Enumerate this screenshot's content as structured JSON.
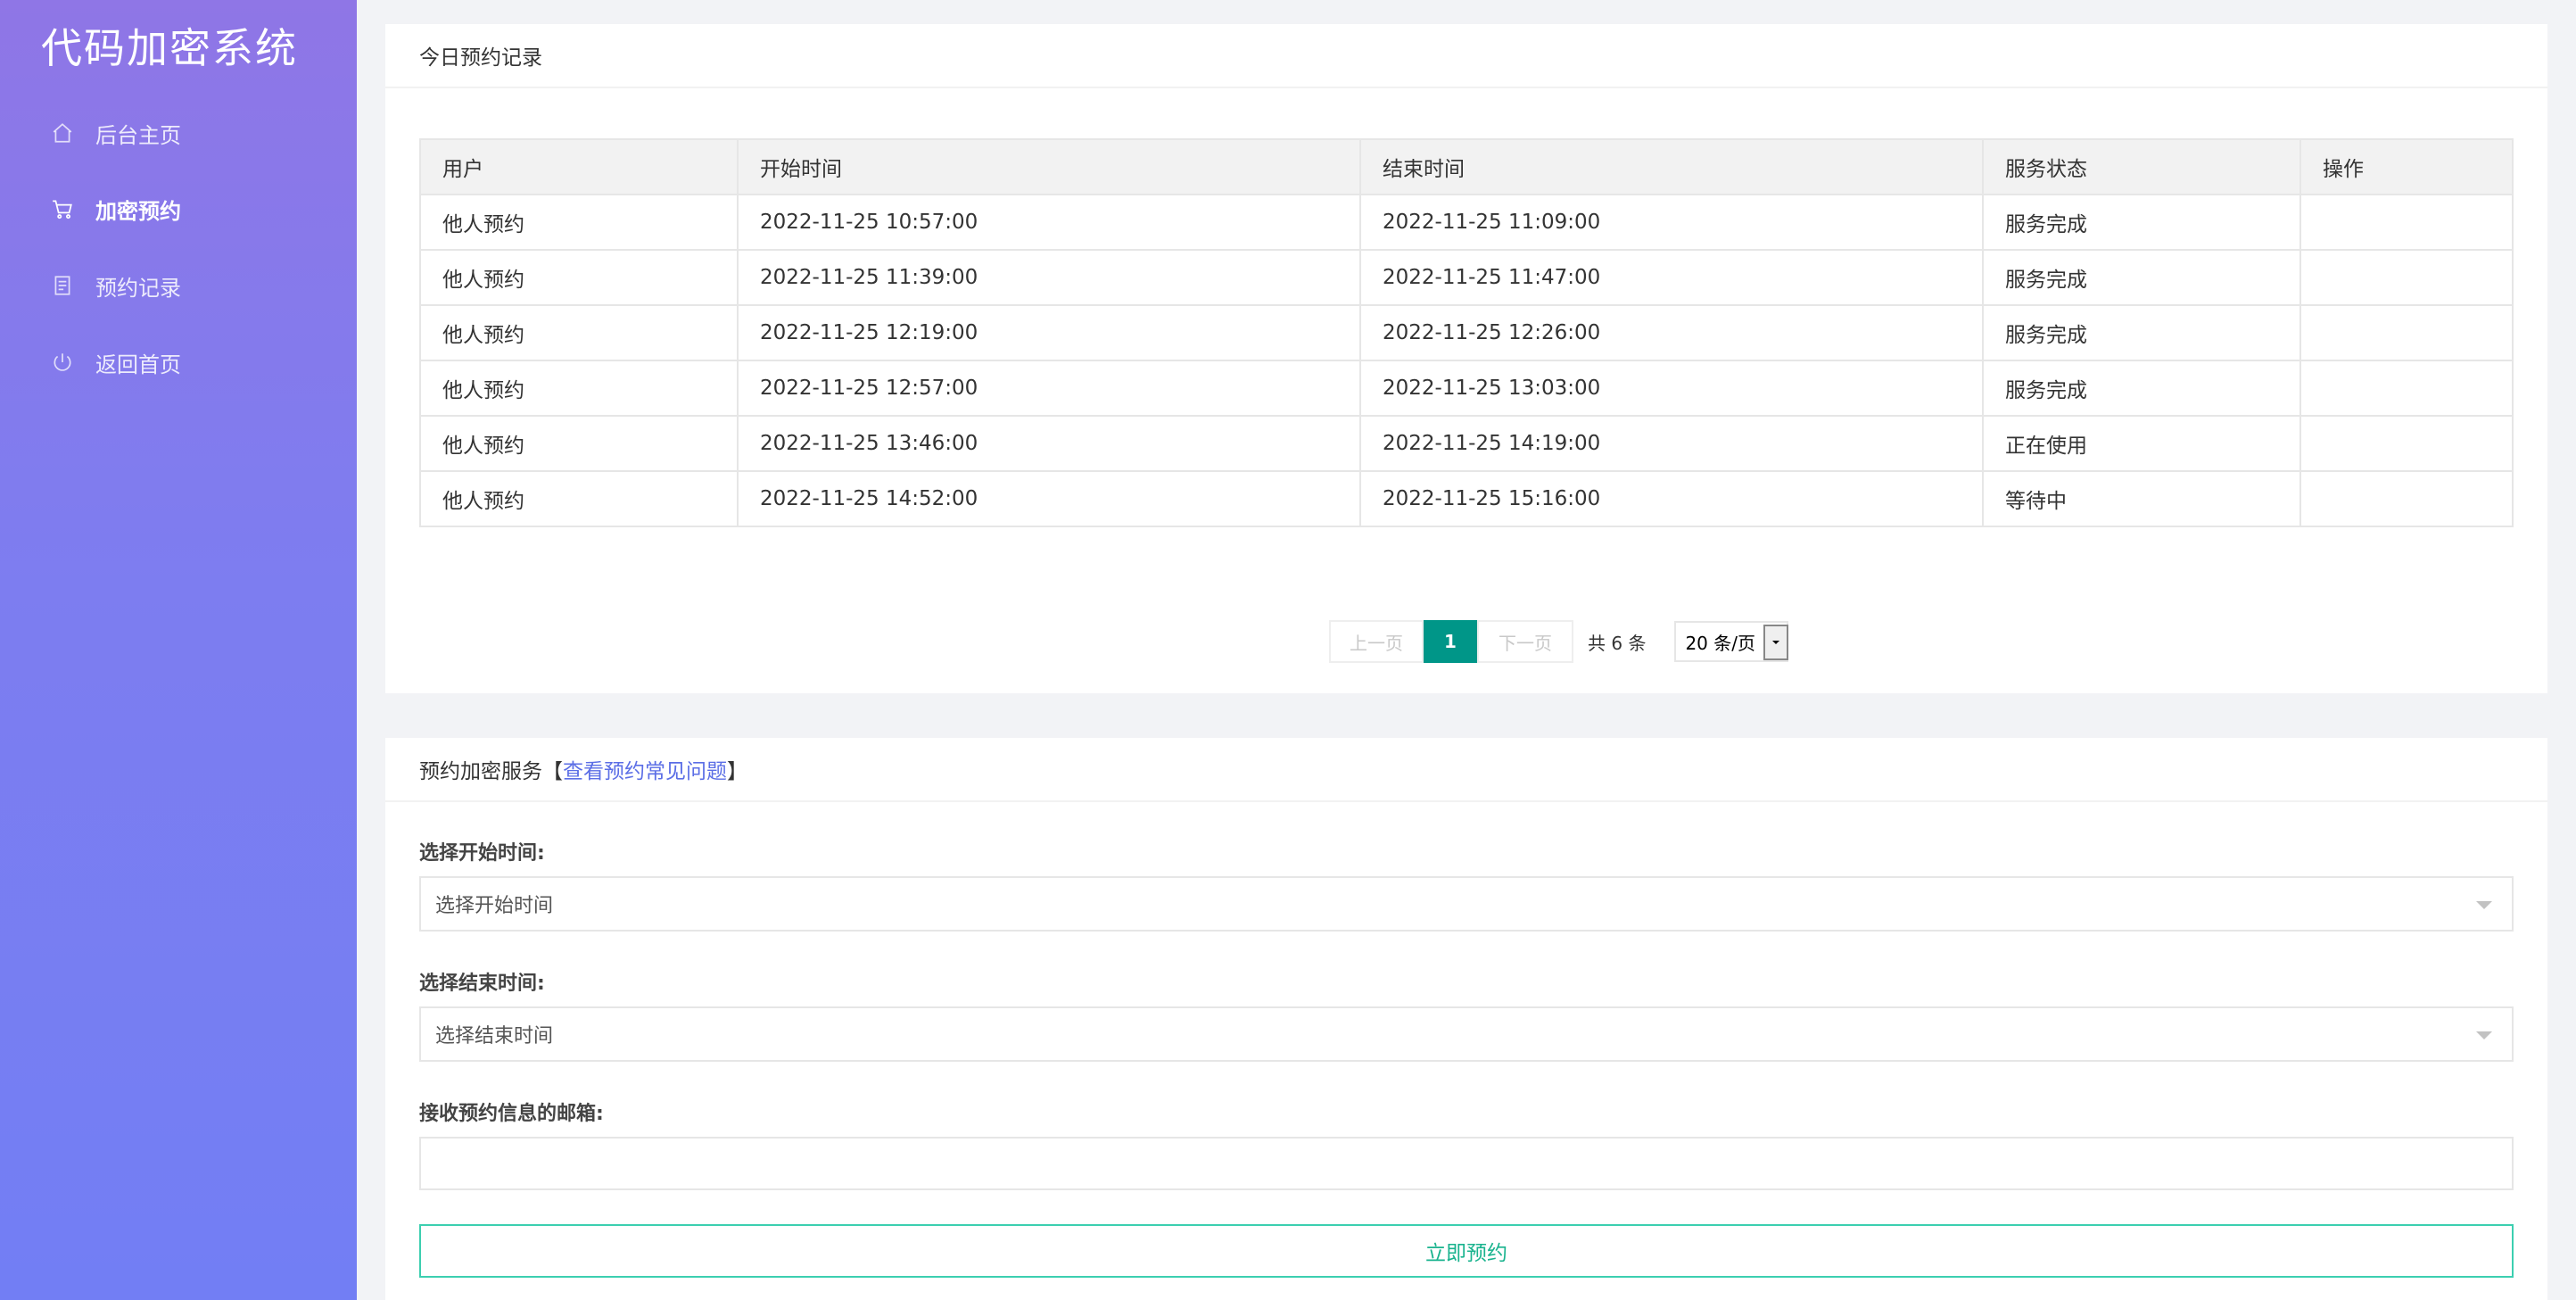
{
  "app": {
    "title": "代码加密系统"
  },
  "sidebar": {
    "items": [
      {
        "label": "后台主页",
        "icon": "home-icon",
        "active": false
      },
      {
        "label": "加密预约",
        "icon": "cart-icon",
        "active": true
      },
      {
        "label": "预约记录",
        "icon": "document-icon",
        "active": false
      },
      {
        "label": "返回首页",
        "icon": "power-icon",
        "active": false
      }
    ]
  },
  "records": {
    "title": "今日预约记录",
    "columns": [
      "用户",
      "开始时间",
      "结束时间",
      "服务状态",
      "操作"
    ],
    "rows": [
      {
        "user": "他人预约",
        "start": "2022-11-25 10:57:00",
        "end": "2022-11-25 11:09:00",
        "status": "服务完成",
        "action": ""
      },
      {
        "user": "他人预约",
        "start": "2022-11-25 11:39:00",
        "end": "2022-11-25 11:47:00",
        "status": "服务完成",
        "action": ""
      },
      {
        "user": "他人预约",
        "start": "2022-11-25 12:19:00",
        "end": "2022-11-25 12:26:00",
        "status": "服务完成",
        "action": ""
      },
      {
        "user": "他人预约",
        "start": "2022-11-25 12:57:00",
        "end": "2022-11-25 13:03:00",
        "status": "服务完成",
        "action": ""
      },
      {
        "user": "他人预约",
        "start": "2022-11-25 13:46:00",
        "end": "2022-11-25 14:19:00",
        "status": "正在使用",
        "action": ""
      },
      {
        "user": "他人预约",
        "start": "2022-11-25 14:52:00",
        "end": "2022-11-25 15:16:00",
        "status": "等待中",
        "action": ""
      }
    ],
    "status_colors": {
      "服务完成": "#6f8aa0",
      "正在使用": "#2eb85c",
      "等待中": "#d08a1c"
    }
  },
  "pager": {
    "prev": "上一页",
    "current": "1",
    "next": "下一页",
    "total": "共 6 条",
    "page_size": "20 条/页"
  },
  "booking": {
    "title_prefix": "预约加密服务【",
    "faq_link": "查看预约常见问题",
    "title_suffix": "】",
    "start_label": "选择开始时间:",
    "start_placeholder": "选择开始时间",
    "end_label": "选择结束时间:",
    "end_placeholder": "选择结束时间",
    "email_label": "接收预约信息的邮箱:",
    "email_value": "",
    "submit_label": "立即预约"
  },
  "colors": {
    "accent": "#009688",
    "sidebar_top": "#8f76e6",
    "sidebar_bottom": "#727ef4",
    "submit": "#19b38e",
    "link": "#5b6ee6"
  }
}
